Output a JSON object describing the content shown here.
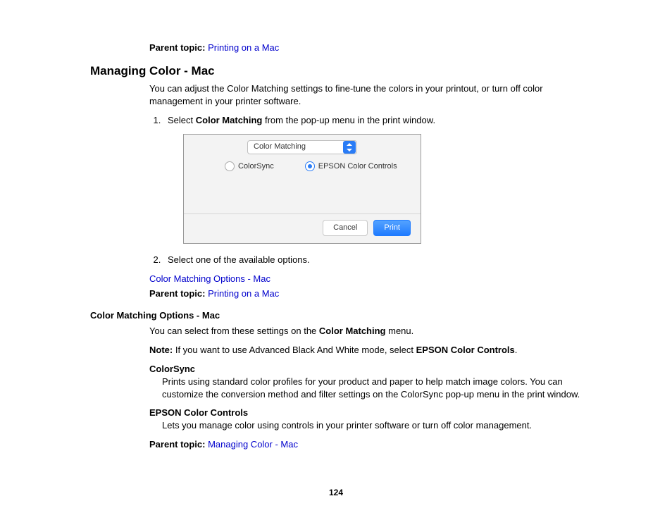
{
  "parentTopic1": {
    "label": "Parent topic:",
    "link": "Printing on a Mac"
  },
  "section1": {
    "title": "Managing Color - Mac",
    "intro": "You can adjust the Color Matching settings to fine-tune the colors in your printout, or turn off color management in your printer software.",
    "step1_prefix": "Select ",
    "step1_bold": "Color Matching",
    "step1_suffix": " from the pop-up menu in the print window.",
    "step2": "Select one of the available options.",
    "relatedLink": "Color Matching Options - Mac",
    "parentTopic": {
      "label": "Parent topic:",
      "link": "Printing on a Mac"
    }
  },
  "dialog": {
    "dropdown": "Color Matching",
    "option1": "ColorSync",
    "option2": "EPSON Color Controls",
    "cancel": "Cancel",
    "print": "Print"
  },
  "section2": {
    "title": "Color Matching Options - Mac",
    "intro_prefix": "You can select from these settings on the ",
    "intro_bold": "Color Matching",
    "intro_suffix": " menu.",
    "note_label": "Note:",
    "note_prefix": " If you want to use Advanced Black And White mode, select ",
    "note_bold": "EPSON Color Controls",
    "note_suffix": ".",
    "def1_term": "ColorSync",
    "def1_body": "Prints using standard color profiles for your product and paper to help match image colors. You can customize the conversion method and filter settings on the ColorSync pop-up menu in the print window.",
    "def2_term": "EPSON Color Controls",
    "def2_body": "Lets you manage color using controls in your printer software or turn off color management.",
    "parentTopic": {
      "label": "Parent topic:",
      "link": "Managing Color - Mac"
    }
  },
  "pageNumber": "124"
}
